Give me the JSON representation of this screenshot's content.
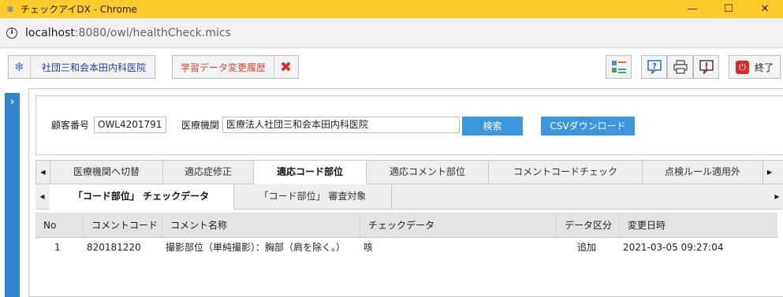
{
  "window": {
    "title": "チェックアイDX - Chrome",
    "controls": {
      "minimize": "—",
      "maximize": "☐",
      "close": "✕"
    }
  },
  "address_bar": {
    "host": "localhost",
    "path": ":8080/owl/healthCheck.mics"
  },
  "toolbar": {
    "clinic_label": "社団三和会本田内科医院",
    "history_label": "学習データ変更履歴",
    "close_glyph": "✖",
    "end_label": "終了"
  },
  "sidebar": {
    "toggle": "›"
  },
  "search": {
    "customer_no_label": "顧客番号",
    "customer_no_value": "OWL4201791",
    "institution_label": "医療機関",
    "institution_value": "医療法人社団三和会本田内科医院",
    "search_button": "検索",
    "csv_button": "CSVダウンロード"
  },
  "tabs_primary": {
    "left_arrow": "◀",
    "right_arrow": "▶",
    "items": [
      "医療機関へ切替",
      "適応症修正",
      "適応コード部位",
      "適応コメント部位",
      "コメントコードチェック",
      "点検ルール適用外"
    ],
    "active_index": 2
  },
  "tabs_secondary": {
    "left_arrow": "◀",
    "right_arrow": "▶",
    "items": [
      "「コード部位」 チェックデータ",
      "「コード部位」 審査対象"
    ],
    "active_index": 0
  },
  "table": {
    "columns": [
      "No",
      "コメントコード",
      "コメント名称",
      "チェックデータ",
      "データ区分",
      "変更日時"
    ],
    "rows": [
      [
        "1",
        "820181220",
        "撮影部位（単純撮影）：胸部（肩を除く。）",
        "咳",
        "追加",
        "2021-03-05 09:27:04"
      ]
    ]
  },
  "icons": {
    "app": "snowflake-icon",
    "info": "info-icon",
    "toolbar_right": [
      "layout-icon",
      "help-icon",
      "print-icon",
      "alert-icon",
      "power-icon"
    ]
  },
  "colors": {
    "titlebar": "#fdcc2a",
    "accent_blue": "#3d95dc",
    "sidebar_blue": "#2f86cf",
    "danger_red": "#d72a2a"
  }
}
